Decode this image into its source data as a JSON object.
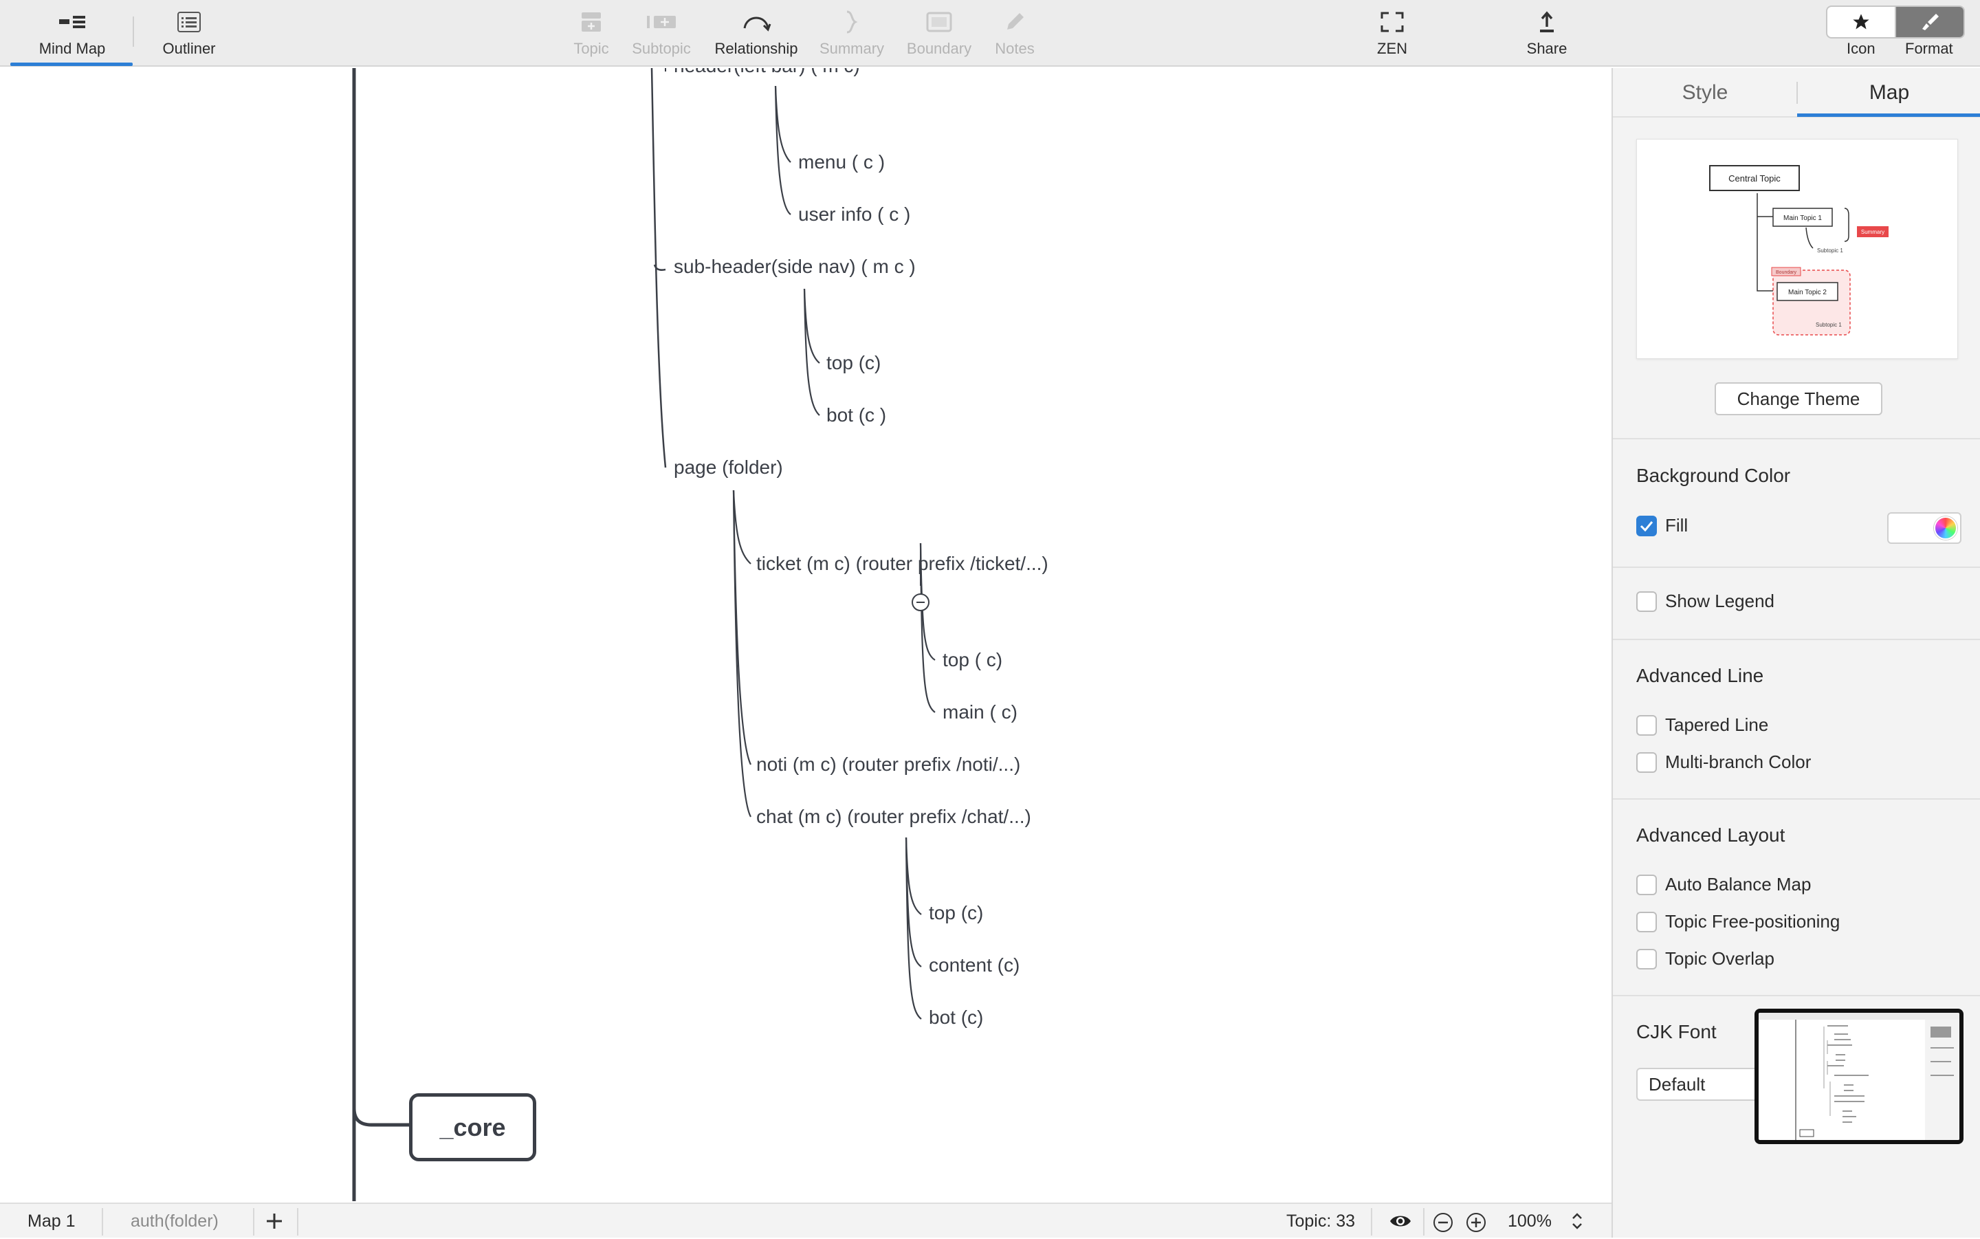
{
  "toolbar": {
    "mind_map": "Mind Map",
    "outliner": "Outliner",
    "topic": "Topic",
    "subtopic": "Subtopic",
    "relationship": "Relationship",
    "summary": "Summary",
    "boundary": "Boundary",
    "notes": "Notes",
    "zen": "ZEN",
    "share": "Share",
    "icon": "Icon",
    "format": "Format"
  },
  "map": {
    "nodes": {
      "header": "header(left bar) ( m c)",
      "menu": "menu ( c )",
      "user_info": "user info ( c )",
      "subheader": "sub-header(side nav) ( m c )",
      "sub_top": "top (c)",
      "sub_bot": "bot (c )",
      "page": "page (folder)",
      "ticket": "ticket  (m c) (router prefix /ticket/...)",
      "ticket_top": "top ( c)",
      "ticket_main": "main ( c)",
      "noti": "noti (m c) (router prefix /noti/...)",
      "chat": "chat (m c) (router prefix /chat/...)",
      "chat_top": "top (c)",
      "chat_content": "content (c)",
      "chat_bot": "bot (c)",
      "core": "_core"
    },
    "line_color": "#3b3f47"
  },
  "panel": {
    "tab_style": "Style",
    "tab_map": "Map",
    "theme_preview": {
      "central": "Central Topic",
      "main1": "Main Topic 1",
      "main2": "Main Topic 2",
      "sub1": "Subtopic 1",
      "sub2": "Subtopic 1",
      "summary": "Summary",
      "boundary": "Boundary"
    },
    "change_theme": "Change Theme",
    "background_color": "Background Color",
    "fill": "Fill",
    "fill_checked": true,
    "show_legend": "Show Legend",
    "advanced_line": "Advanced Line",
    "tapered_line": "Tapered Line",
    "multi_branch_color": "Multi-branch Color",
    "advanced_layout": "Advanced Layout",
    "auto_balance": "Auto Balance Map",
    "free_positioning": "Topic Free-positioning",
    "topic_overlap": "Topic Overlap",
    "cjk_font": "CJK Font",
    "cjk_font_value": "Default",
    "accent": "#2d7fd6",
    "summary_color": "#e8484a"
  },
  "status": {
    "sheet1": "Map 1",
    "sheet2": "auth(folder)",
    "topic_count": "Topic: 33",
    "zoom": "100%"
  }
}
